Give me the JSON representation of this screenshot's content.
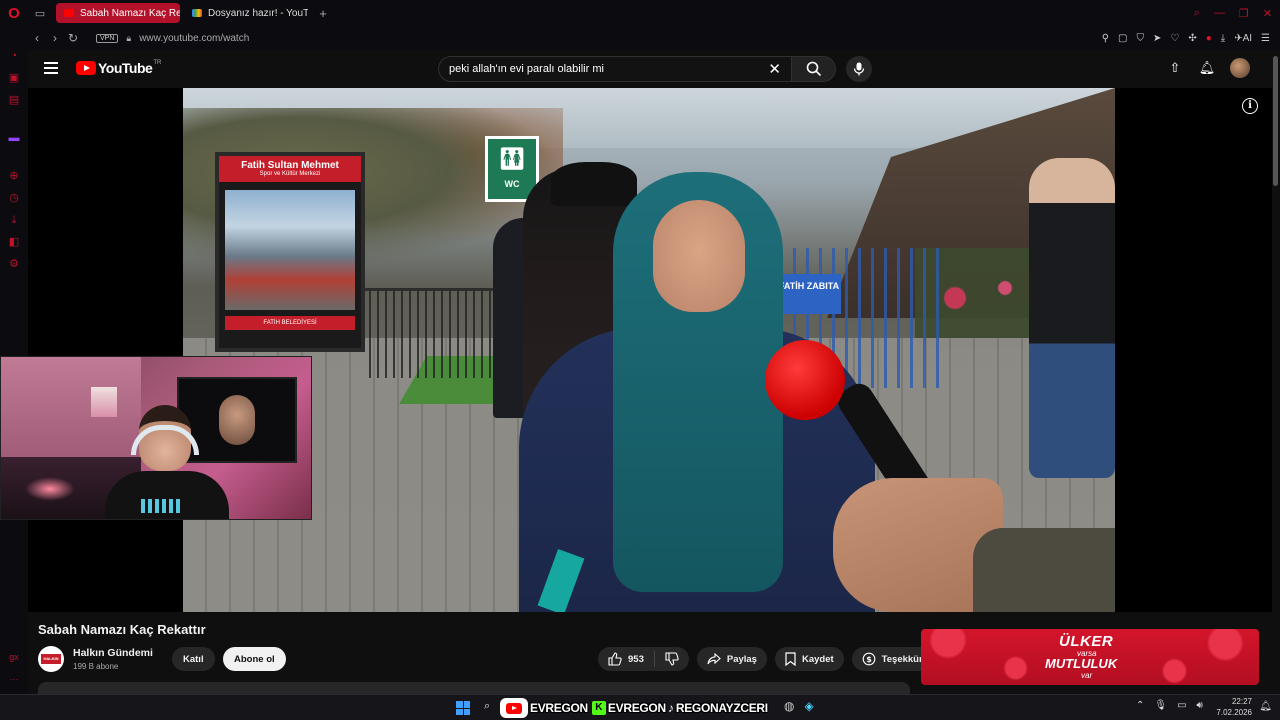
{
  "browser": {
    "tabs": [
      {
        "label": "Sabah Namazı Kaç Rekattır",
        "active": true
      },
      {
        "label": "Dosyanız hazır! - YouTube",
        "active": false
      }
    ],
    "new_tab_label": "+",
    "url": "www.youtube.com/watch",
    "vpn_label": "VPN",
    "ai_label": "AI",
    "brand_color": "#e0102a"
  },
  "youtube": {
    "logo_text": "YouTube",
    "country_code": "TR",
    "search_value": "peki allah'ın evi paralı olabilir mi"
  },
  "player": {
    "billboard_title": "Fatih Sultan Mehmet",
    "billboard_subtitle": "Spor ve Kültür Merkezi",
    "billboard_footer": "FATİH BELEDİYESİ",
    "wc_sign": "WC",
    "fatih_sign": "FATİH ZABITA"
  },
  "video": {
    "title": "Sabah Namazı Kaç Rekattır",
    "channel_name": "Halkın Gündemi",
    "subscribers": "199 B abone",
    "join_label": "Katıl",
    "subscribe_label": "Abone ol",
    "likes": "953",
    "share_label": "Paylaş",
    "save_label": "Kaydet",
    "thanks_label": "Teşekkürler"
  },
  "ad": {
    "brand": "ÜLKER",
    "line2": "varsa",
    "line3": "MUTLULUK",
    "line4": "var"
  },
  "taskbar": {
    "stream_names": [
      "EVREGON",
      "EVREGON",
      "REGONAYZCERI"
    ],
    "kick_letter": "K",
    "time": "22:27",
    "date": "7.02.2026"
  },
  "colors": {
    "yt_red": "#ff0000",
    "accent_dark": "#0f0f0f",
    "pill_bg": "#272727"
  }
}
